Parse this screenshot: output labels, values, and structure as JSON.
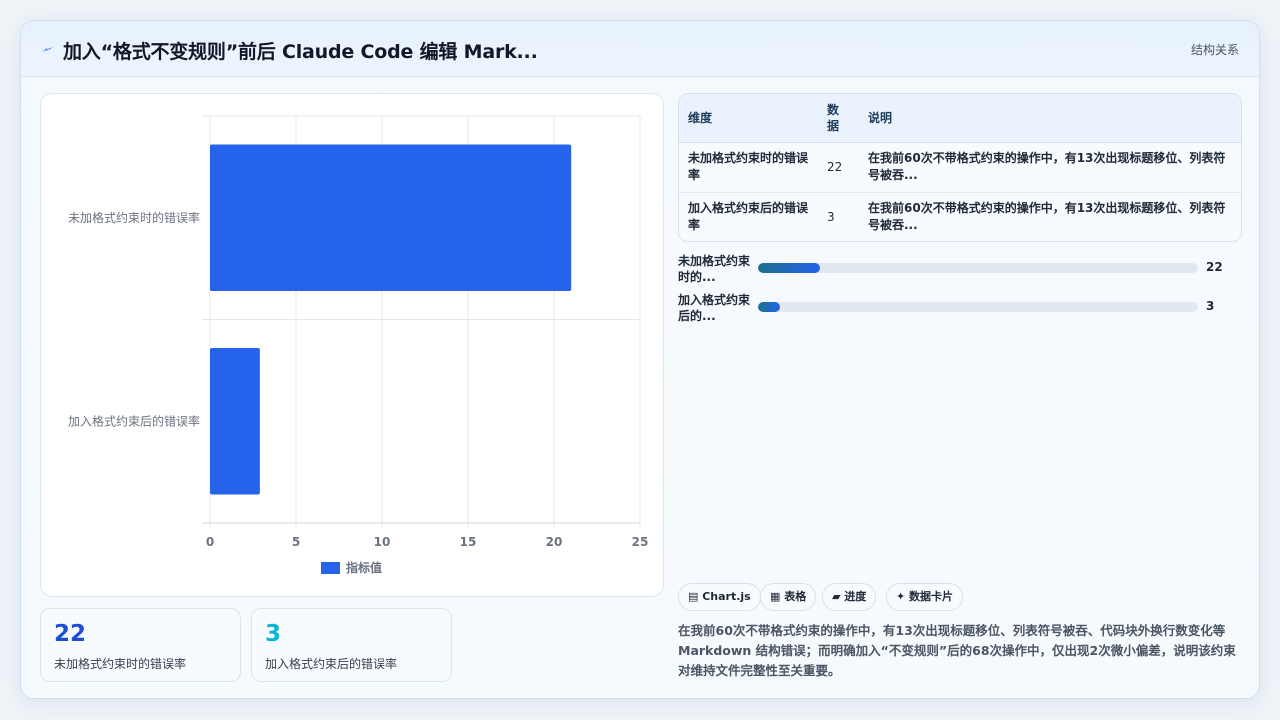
{
  "header": {
    "title": "加入“格式不变规则”前后 Claude Code 编辑 Mark...",
    "tag": "结构关系"
  },
  "chart_data": {
    "type": "bar",
    "orientation": "horizontal",
    "categories": [
      "未加格式约束时的错误率",
      "加入格式约束后的错误率"
    ],
    "series": [
      {
        "name": "指标值",
        "values": [
          21,
          2.9
        ]
      }
    ],
    "x_ticks": [
      "0",
      "5",
      "10",
      "15",
      "20",
      "25"
    ],
    "xlim": [
      0,
      25
    ],
    "grid": true,
    "legend_position": "bottom",
    "color": "#2563eb"
  },
  "stats": [
    {
      "value": "22",
      "label": "未加格式约束时的错误率",
      "color": "#1d4ed8"
    },
    {
      "value": "3",
      "label": "加入格式约束后的错误率",
      "color": "#06b6d4"
    }
  ],
  "table": {
    "headers": [
      "维度",
      "数据",
      "说明"
    ],
    "rows": [
      {
        "dim": "未加格式约束时的错误率",
        "data": "22",
        "desc": "在我前60次不带格式约束的操作中，有13次出现标题移位、列表符号被吞..."
      },
      {
        "dim": "加入格式约束后的错误率",
        "data": "3",
        "desc": "在我前60次不带格式约束的操作中，有13次出现标题移位、列表符号被吞..."
      }
    ]
  },
  "progress": [
    {
      "label": "未加格式约束时的...",
      "value": "22",
      "fraction": 0.14
    },
    {
      "label": "加入格式约束后的...",
      "value": "3",
      "fraction": 0.05
    }
  ],
  "chips": [
    "▤ Chart.js",
    "▦ 表格",
    "▰ 进度",
    "✦ 数据卡片"
  ],
  "summary": "在我前60次不带格式约束的操作中，有13次出现标题移位、列表符号被吞、代码块外换行数变化等 Markdown 结构错误；而明确加入“不变规则”后的68次操作中，仅出现2次微小偏差，说明该约束对维持文件完整性至关重要。",
  "colors": {
    "accent": "#2563eb",
    "teal": "#1d6f8d"
  }
}
